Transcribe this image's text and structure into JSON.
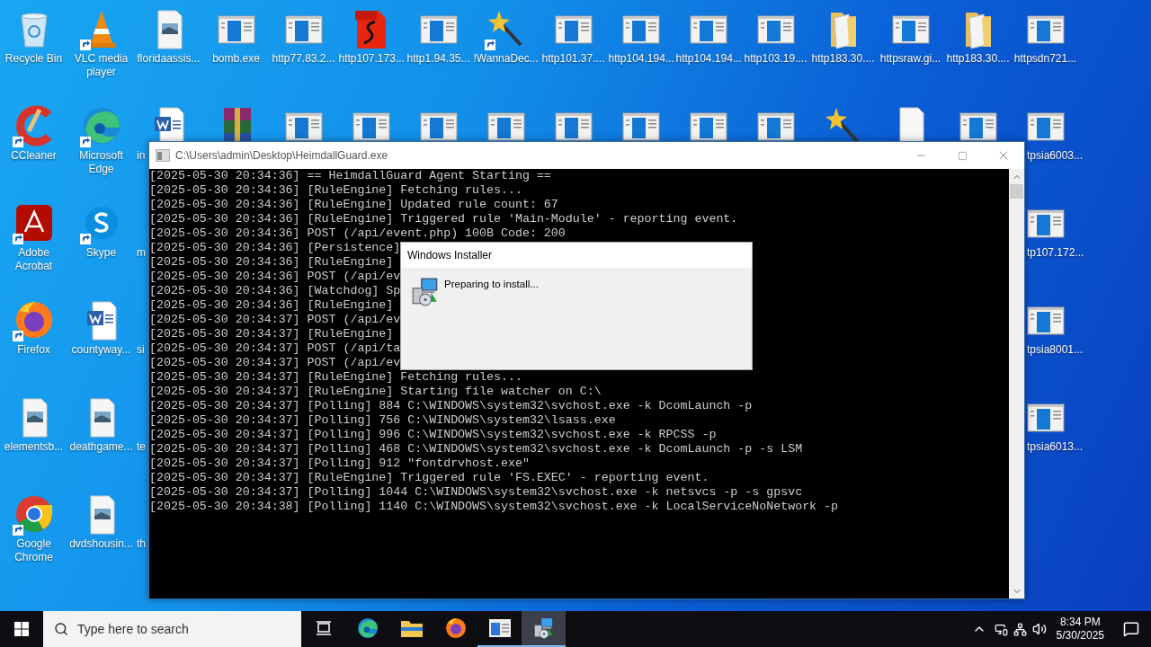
{
  "desktop": {
    "rows": [
      {
        "left": [
          {
            "kind": "recycle",
            "label": "Recycle Bin"
          },
          {
            "kind": "vlc",
            "label": "VLC media player",
            "shortcut": true
          },
          {
            "kind": "image",
            "label": "floridaassis..."
          },
          {
            "kind": "exe",
            "label": "bomb.exe"
          },
          {
            "kind": "exe",
            "label": "http77.83.2..."
          },
          {
            "kind": "pdf",
            "label": "http107.173..."
          },
          {
            "kind": "exe",
            "label": "http1.94.35..."
          },
          {
            "kind": "wand",
            "label": "!WannaDec...",
            "shortcut": true
          },
          {
            "kind": "exe",
            "label": "http101.37...."
          },
          {
            "kind": "exe",
            "label": "http104.194..."
          },
          {
            "kind": "exe",
            "label": "http104.194..."
          },
          {
            "kind": "exe",
            "label": "http103.19...."
          },
          {
            "kind": "folder",
            "label": "http183.30...."
          },
          {
            "kind": "exe",
            "label": "httpsraw.gi..."
          },
          {
            "kind": "folder",
            "label": "http183.30...."
          },
          {
            "kind": "exe",
            "label": "httpsdn721..."
          }
        ]
      },
      {
        "left": [
          {
            "kind": "ccleaner",
            "label": "CCleaner",
            "shortcut": true
          },
          {
            "kind": "edge",
            "label": "Microsoft Edge",
            "shortcut": true
          },
          {
            "kind": "word",
            "label": "in"
          },
          {
            "kind": "winrar"
          },
          {
            "kind": "exe"
          },
          {
            "kind": "exe"
          },
          {
            "kind": "exe"
          },
          {
            "kind": "exe"
          },
          {
            "kind": "exe"
          },
          {
            "kind": "exe"
          },
          {
            "kind": "exe"
          },
          {
            "kind": "exe"
          },
          {
            "kind": "wand"
          },
          {
            "kind": "blank"
          },
          {
            "kind": "exe"
          },
          {
            "kind": "exe",
            "label": "tpsia6003..."
          }
        ]
      },
      {
        "left": [
          {
            "kind": "acrobat",
            "label": "Adobe Acrobat",
            "shortcut": true
          },
          {
            "kind": "skype",
            "label": "Skype",
            "shortcut": true
          },
          {
            "kind": "none",
            "label": "m"
          }
        ],
        "right": [
          {
            "kind": "exe",
            "label": "tp107.172..."
          }
        ]
      },
      {
        "left": [
          {
            "kind": "firefox",
            "label": "Firefox",
            "shortcut": true
          },
          {
            "kind": "word",
            "label": "countyway..."
          },
          {
            "kind": "none",
            "label": "si"
          }
        ],
        "right": [
          {
            "kind": "exe",
            "label": "tpsia8001..."
          }
        ]
      },
      {
        "left": [
          {
            "kind": "image",
            "label": "elementsb..."
          },
          {
            "kind": "image",
            "label": "deathgame..."
          },
          {
            "kind": "none",
            "label": "te"
          }
        ],
        "right": [
          {
            "kind": "exe",
            "label": "tpsia6013..."
          }
        ]
      },
      {
        "left": [
          {
            "kind": "chrome",
            "label": "Google Chrome",
            "shortcut": true
          },
          {
            "kind": "image",
            "label": "dvdshousin..."
          },
          {
            "kind": "none",
            "label": "th"
          }
        ]
      }
    ]
  },
  "console_window": {
    "title": "C:\\Users\\admin\\Desktop\\HeimdallGuard.exe",
    "lines": [
      "[2025-05-30 20:34:36] == HeimdallGuard Agent Starting ==",
      "[2025-05-30 20:34:36] [RuleEngine] Fetching rules...",
      "[2025-05-30 20:34:36] [RuleEngine] Updated rule count: 67",
      "[2025-05-30 20:34:36] [RuleEngine] Triggered rule 'Main-Module' - reporting event.",
      "[2025-05-30 20:34:36] POST (/api/event.php) 100B Code: 200",
      "[2025-05-30 20:34:36] [Persistence]",
      "[2025-05-30 20:34:36] [RuleEngine]",
      "[2025-05-30 20:34:36] POST (/api/ev",
      "[2025-05-30 20:34:36] [Watchdog] Sp",
      "[2025-05-30 20:34:36] [RuleEngine]",
      "[2025-05-30 20:34:37] POST (/api/ev",
      "[2025-05-30 20:34:37] [RuleEngine]",
      "[2025-05-30 20:34:37] POST (/api/ta",
      "[2025-05-30 20:34:37] POST (/api/ev",
      "[2025-05-30 20:34:37] [RuleEngine] Fetching rules...",
      "[2025-05-30 20:34:37] [RuleEngine] Starting file watcher on C:\\",
      "[2025-05-30 20:34:37] [Polling] 884 C:\\WINDOWS\\system32\\svchost.exe -k DcomLaunch -p",
      "[2025-05-30 20:34:37] [Polling] 756 C:\\WINDOWS\\system32\\lsass.exe",
      "[2025-05-30 20:34:37] [Polling] 996 C:\\WINDOWS\\system32\\svchost.exe -k RPCSS -p",
      "[2025-05-30 20:34:37] [Polling] 468 C:\\WINDOWS\\system32\\svchost.exe -k DcomLaunch -p -s LSM",
      "[2025-05-30 20:34:37] [Polling] 912 \"fontdrvhost.exe\"",
      "[2025-05-30 20:34:37] [RuleEngine] Triggered rule 'FS.EXEC' - reporting event.",
      "[2025-05-30 20:34:37] [Polling] 1044 C:\\WINDOWS\\system32\\svchost.exe -k netsvcs -p -s gpsvc",
      "[2025-05-30 20:34:38] [Polling] 1140 C:\\WINDOWS\\system32\\svchost.exe -k LocalServiceNoNetwork -p"
    ]
  },
  "installer_dialog": {
    "title": "Windows Installer",
    "message": "Preparing to install..."
  },
  "taskbar": {
    "search": {
      "placeholder": "Type here to search"
    },
    "apps": [
      {
        "kind": "taskview",
        "running": false,
        "selected": false
      },
      {
        "kind": "edge",
        "running": false,
        "selected": false
      },
      {
        "kind": "explorer",
        "running": false,
        "selected": false
      },
      {
        "kind": "firefox",
        "running": false,
        "selected": false
      },
      {
        "kind": "console",
        "running": true,
        "selected": false
      },
      {
        "kind": "installer",
        "running": true,
        "selected": true
      }
    ],
    "clock": {
      "time": "8:34 PM",
      "date": "5/30/2025"
    }
  }
}
